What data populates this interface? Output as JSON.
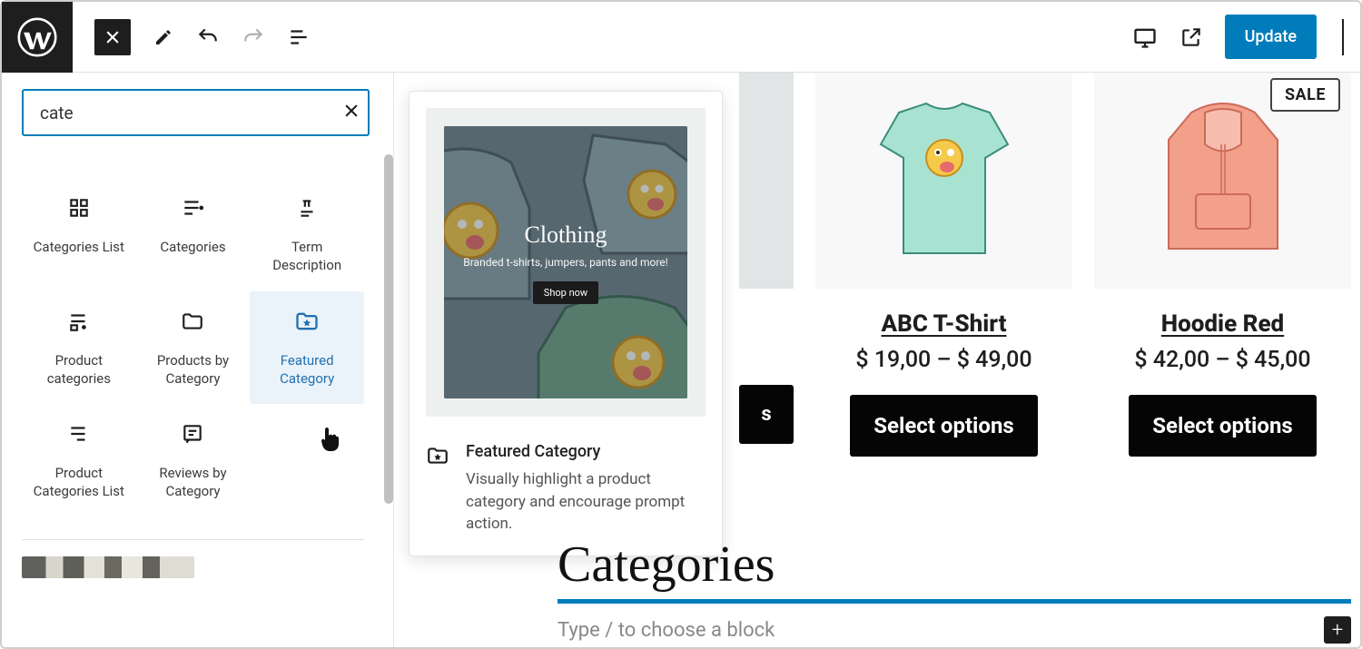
{
  "topbar": {
    "update_label": "Update"
  },
  "inserter": {
    "search_value": "cate",
    "blocks": [
      {
        "label": "Categories List"
      },
      {
        "label": "Categories"
      },
      {
        "label": "Term Description"
      },
      {
        "label": "Product categories"
      },
      {
        "label": "Products by Category"
      },
      {
        "label": "Featured Category",
        "selected": true
      },
      {
        "label": "Product Categories List"
      },
      {
        "label": "Reviews by Category"
      }
    ]
  },
  "popover": {
    "hero_title": "Clothing",
    "hero_sub": "Branded t-shirts, jumpers, pants and more!",
    "hero_cta": "Shop now",
    "title": "Featured Category",
    "desc": "Visually highlight a product category and encourage prompt action."
  },
  "products": [
    {
      "title": "ABC T-Shirt",
      "price": "$ 19,00 – $ 49,00",
      "cta": "Select options",
      "sale": false
    },
    {
      "title": "Hoodie Red",
      "price": "$ 42,00 – $ 45,00",
      "cta": "Select options",
      "sale": true
    }
  ],
  "partial_product": {
    "cta": "s"
  },
  "sale_label": "SALE",
  "categories_heading": "Categories",
  "slash_placeholder": "Type / to choose a block"
}
